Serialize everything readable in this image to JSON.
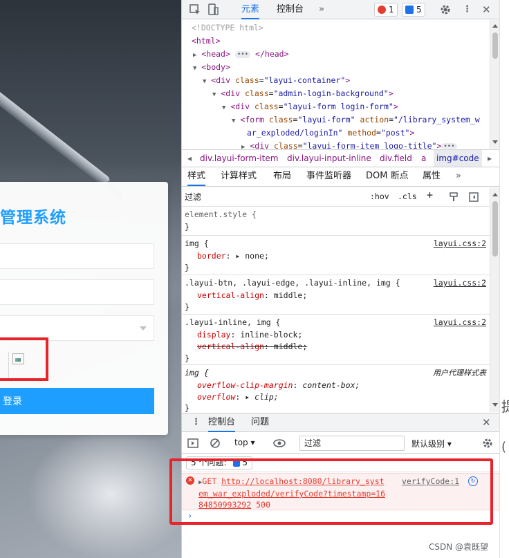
{
  "login": {
    "title": "管理系统",
    "login_button": "登录"
  },
  "devtools": {
    "tabs": [
      "元素",
      "控制台"
    ],
    "error_badge": "1",
    "message_badge": "5",
    "elements": {
      "doctype": "<!DOCTYPE html>",
      "lines": [
        {
          "tag": "html",
          "text": "<html>"
        },
        {
          "tag": "head",
          "text": "<head>",
          "close": "</head>"
        },
        {
          "tag": "body",
          "text": "<body>"
        },
        {
          "tag": "div",
          "attr": "class",
          "val": "\"layui-container\""
        },
        {
          "tag": "div",
          "attr": "class",
          "val": "\"admin-login-background\""
        },
        {
          "tag": "div",
          "attr": "class",
          "val": "\"layui-form login-form\""
        },
        {
          "tag": "form",
          "attr": "class",
          "val": "\"layui-form\"",
          "attr2": "action",
          "val2": "\"/library_system_w",
          "cont": "ar_exploded/loginIn\"",
          "attr3": "method",
          "val3": "\"post\""
        },
        {
          "tag": "div",
          "attr": "class",
          "val": "\"layui-form-item logo-title\""
        }
      ]
    },
    "breadcrumbs": [
      "div.layui-form-item",
      "div.layui-input-inline",
      "div.field",
      "a",
      "img#code"
    ],
    "styles_tabs": [
      "样式",
      "计算样式",
      "布局",
      "事件监听器",
      "DOM 断点",
      "属性"
    ],
    "filter_placeholder": "过滤",
    "filter_buttons": [
      ":hov",
      ".cls",
      "+"
    ],
    "rules": [
      {
        "selector": "element.style {",
        "source": "",
        "decls": [],
        "close": "}"
      },
      {
        "selector": "img {",
        "source": "layui.css:2",
        "decls": [
          {
            "name": "border",
            "value": "▸ none;"
          }
        ],
        "close": "}"
      },
      {
        "selector": ".layui-btn, .layui-edge, .layui-inline, img {",
        "source": "layui.css:2",
        "decls": [
          {
            "name": "vertical-align",
            "value": "middle;"
          }
        ],
        "close": "}"
      },
      {
        "selector": ".layui-inline, img {",
        "source": "layui.css:2",
        "decls": [
          {
            "name": "display",
            "value": "inline-block;"
          },
          {
            "name": "vertical-align",
            "value": "middle;",
            "struck": true
          }
        ],
        "close": "}"
      },
      {
        "selector": "img {",
        "source": "用户代理样式表",
        "decls": [
          {
            "name": "overflow-clip-margin",
            "value": "content-box;"
          },
          {
            "name": "overflow",
            "value": "▸ clip;"
          }
        ],
        "close": "}"
      }
    ],
    "drawer": {
      "tabs": [
        "控制台",
        "问题"
      ],
      "context": "top",
      "filter_placeholder": "过滤",
      "level": "默认级别",
      "issues_label": "5 个问题:",
      "issues_count": "5",
      "error": {
        "method": "GET",
        "url": "http://localhost:8080/library_system_war_exploded/verifyCode?timestamp=1684850993292",
        "url_line1": "http://localhost:8080/library_syst",
        "url_line2": "em_war_exploded/verifyCode?timestamp=16",
        "url_line3": "84850993292",
        "status": "500",
        "source": "verifyCode:1"
      }
    }
  },
  "watermark": "CSDN @袁既望",
  "colors": {
    "accent": "#1e9fff",
    "highlight": "#e8232a",
    "devtools_blue": "#1a73e8",
    "error": "#e43d2f"
  }
}
